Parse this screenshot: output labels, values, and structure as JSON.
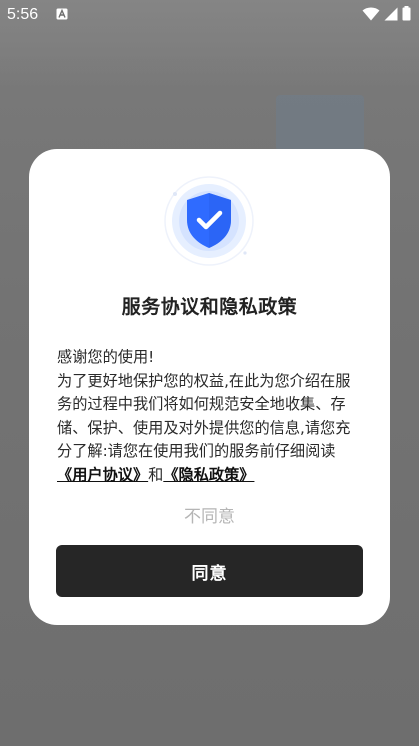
{
  "status_bar": {
    "time": "5:56",
    "notification_icon": "a-box-icon",
    "icons": [
      "wifi-icon",
      "signal-icon",
      "battery-icon"
    ]
  },
  "dialog": {
    "icon": "shield-check-icon",
    "title": "服务协议和隐私政策",
    "body": {
      "greeting": "感谢您的使用!",
      "text": "为了更好地保护您的权益,在此为您介绍在服务的过程中我们将如何规范安全地收集、存储、保护、使用及对外提供您的信息,请您充分了解:请您在使用我们的服务前仔细阅读",
      "user_agreement_link": "《用户协议》",
      "conjunction": "和",
      "privacy_policy_link": "《隐私政策》"
    },
    "disagree_label": "不同意",
    "agree_label": "同意"
  },
  "colors": {
    "overlay": "#6f6f6f",
    "dialog_bg": "#ffffff",
    "shield_blue": "#2f6bff",
    "agree_bg": "#262626",
    "disagree_text": "#b5b5b5"
  }
}
